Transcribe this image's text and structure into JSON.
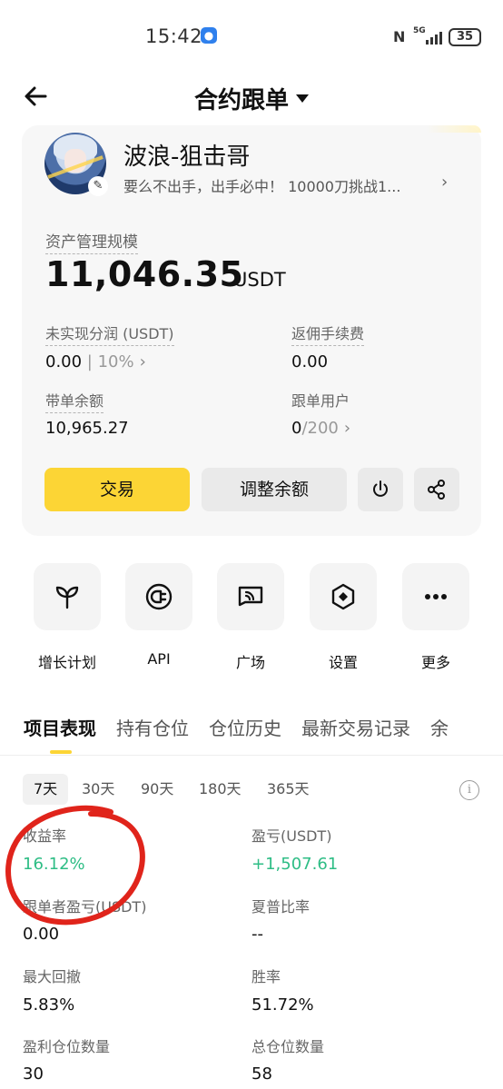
{
  "status_bar": {
    "time": "15:42",
    "network": "5G",
    "battery": "35"
  },
  "nav": {
    "title": "合约跟单",
    "back_icon": "arrow-left-icon",
    "dropdown_icon": "caret-down-icon"
  },
  "profile": {
    "name": "波浪-狙击哥",
    "bio": "要么不出手，出手必中！  10000刀挑战1...",
    "aum_label": "资产管理规模",
    "aum_value": "11,046.35",
    "aum_unit": "USDT",
    "stats": {
      "unrealized_label": "未实现分润 (USDT)",
      "unrealized_value": "0.00",
      "unrealized_sep": " | ",
      "unrealized_pct": "10%",
      "rebate_label": "返佣手续费",
      "rebate_value": "0.00",
      "balance_label": "带单余额",
      "balance_value": "10,965.27",
      "followers_label": "跟单用户",
      "followers_value": "0",
      "followers_max": "/200"
    },
    "buttons": {
      "trade": "交易",
      "adjust": "调整余额"
    }
  },
  "shortcuts": [
    {
      "label": "增长计划",
      "icon": "sprout-icon"
    },
    {
      "label": "API",
      "icon": "api-plug-icon"
    },
    {
      "label": "广场",
      "icon": "broadcast-icon"
    },
    {
      "label": "设置",
      "icon": "settings-diamond-icon"
    },
    {
      "label": "更多",
      "icon": "more-dots-icon"
    }
  ],
  "tabs": [
    "项目表现",
    "持有仓位",
    "仓位历史",
    "最新交易记录",
    "余"
  ],
  "periods": [
    "7天",
    "30天",
    "90天",
    "180天",
    "365天"
  ],
  "metrics": {
    "roi_label": "收益率",
    "roi_value": "16.12%",
    "pnl_label": "盈亏(USDT)",
    "pnl_value": "+1,507.61",
    "follower_pnl_label": "跟单者盈亏(USDT)",
    "follower_pnl_value": "0.00",
    "sharpe_label": "夏普比率",
    "sharpe_value": "--",
    "drawdown_label": "最大回撤",
    "drawdown_value": "5.83%",
    "winrate_label": "胜率",
    "winrate_value": "51.72%",
    "profit_positions_label": "盈利仓位数量",
    "profit_positions_value": "30",
    "total_positions_label": "总仓位数量",
    "total_positions_value": "58"
  },
  "colors": {
    "accent": "#fcd535",
    "positive": "#2ebd85",
    "annotation": "#e0241b"
  }
}
